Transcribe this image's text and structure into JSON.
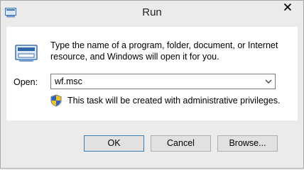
{
  "window": {
    "title": "Run",
    "icon": "run-app-icon",
    "close_glyph": "close-icon"
  },
  "content": {
    "icon": "run-dialog-icon",
    "description": "Type the name of a program, folder, document, or Internet resource, and Windows will open it for you.",
    "open_label": "Open:",
    "open_value": "wf.msc",
    "admin_icon": "uac-shield-icon",
    "admin_text": "This task will be created with administrative privileges."
  },
  "buttons": {
    "ok": "OK",
    "cancel": "Cancel",
    "browse": "Browse..."
  },
  "colors": {
    "window_bg": "#ebebeb",
    "content_bg": "#ffffff",
    "button_bg": "#e1e1e1",
    "default_button_border": "#3c7fb1"
  }
}
